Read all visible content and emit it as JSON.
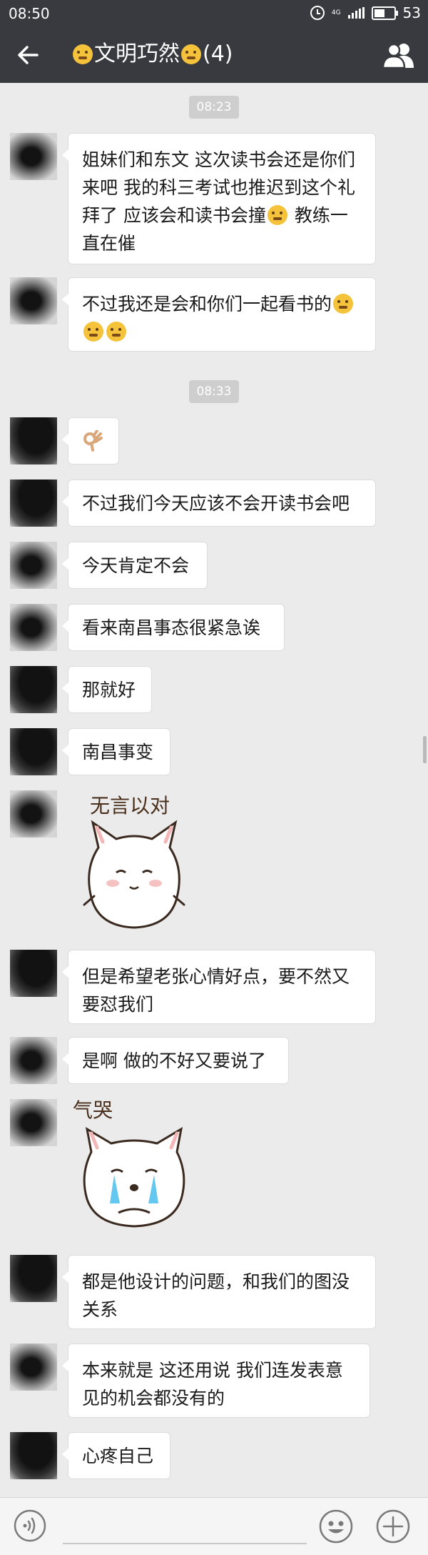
{
  "status_bar": {
    "time": "08:50",
    "network": "4G",
    "battery": "53",
    "battery_level": 0.53
  },
  "header": {
    "title": "文明巧然",
    "member_count": "(4)"
  },
  "messages": [
    {
      "type": "timestamp",
      "text": "08:23"
    },
    {
      "type": "text",
      "avatar": "light",
      "text": "姐妹们和东文 这次读书会还是你们来吧 我的科三考试也推迟到这个礼拜了 应该会和读书会撞",
      "after_text": " 教练一直在催",
      "emojis": [
        "winking-tongue-emoji"
      ]
    },
    {
      "type": "text",
      "avatar": "light",
      "text": "不过我还是会和你们一起看书的",
      "emojis": [
        "headband-emoji",
        "headband-emoji",
        "headband-emoji"
      ]
    },
    {
      "type": "timestamp",
      "text": "08:33"
    },
    {
      "type": "emoji_only",
      "avatar": "dark",
      "emojis": [
        "ok-hand-emoji"
      ]
    },
    {
      "type": "text",
      "avatar": "dark",
      "text": "不过我们今天应该不会开读书会吧"
    },
    {
      "type": "text",
      "avatar": "light",
      "text": "今天肯定不会"
    },
    {
      "type": "text",
      "avatar": "light",
      "text": "看来南昌事态很紧急诶"
    },
    {
      "type": "text",
      "avatar": "dark",
      "text": "那就好"
    },
    {
      "type": "text",
      "avatar": "dark",
      "text": "南昌事变"
    },
    {
      "type": "sticker",
      "avatar": "light",
      "caption": "无言以对",
      "sticker": "speechless-cat-sticker"
    },
    {
      "type": "text",
      "avatar": "dark",
      "text": "但是希望老张心情好点，要不然又要怼我们"
    },
    {
      "type": "text",
      "avatar": "light",
      "text": "是啊 做的不好又要说了"
    },
    {
      "type": "sticker",
      "avatar": "light",
      "caption": "气哭",
      "sticker": "crying-cat-sticker"
    },
    {
      "type": "text",
      "avatar": "dark",
      "text": "都是他设计的问题，和我们的图没关系"
    },
    {
      "type": "text",
      "avatar": "light",
      "text": "本来就是 这还用说 我们连发表意见的机会都没有的"
    },
    {
      "type": "text",
      "avatar": "dark",
      "text": "心疼自己"
    }
  ],
  "icons": {
    "back": "back-arrow-icon",
    "group": "group-members-icon",
    "voice": "voice-input-icon",
    "sticker": "emoji-face-icon",
    "more": "plus-icon"
  },
  "colors": {
    "bar": "#393a3f",
    "chat_bg": "#ebebeb",
    "bubble": "#ffffff",
    "timestamp_bg": "#cecece"
  }
}
